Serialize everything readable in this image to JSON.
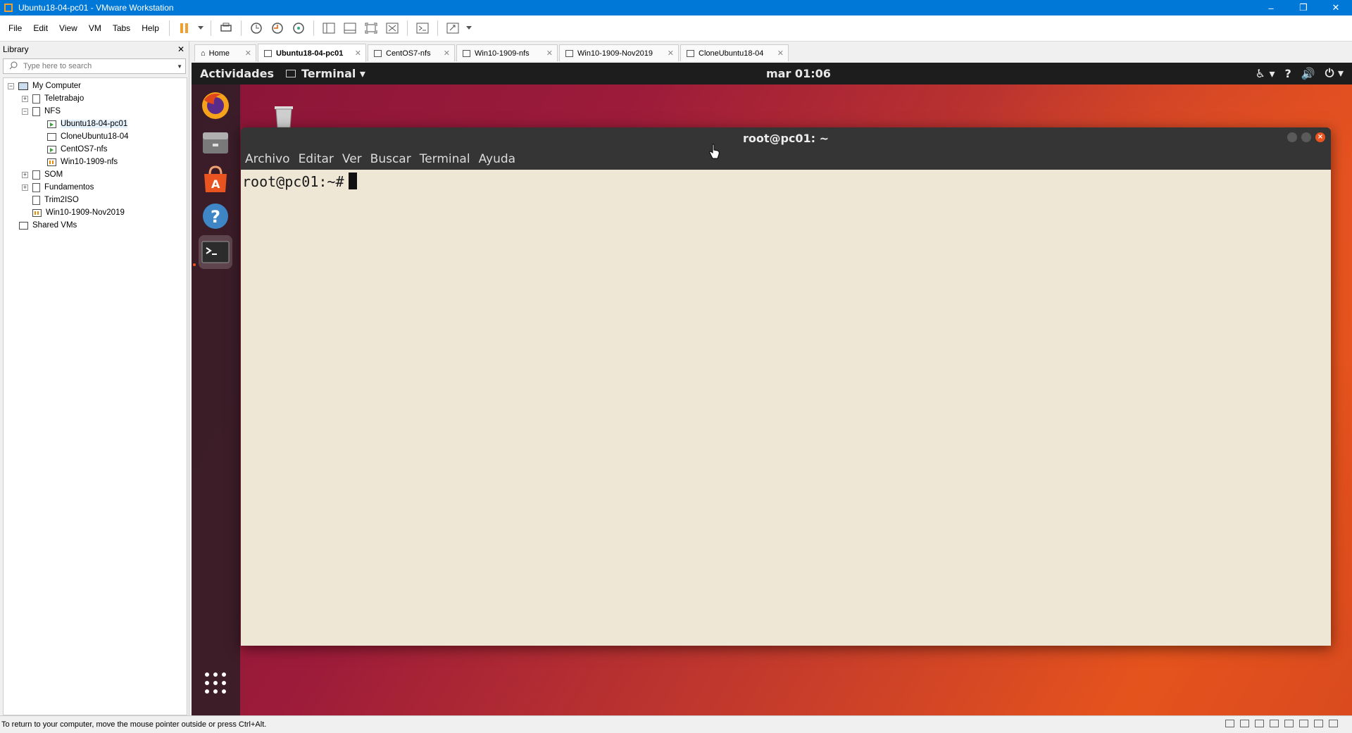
{
  "window": {
    "title": "Ubuntu18-04-pc01 - VMware Workstation",
    "controls": [
      "–",
      "❐",
      "✕"
    ]
  },
  "menubar": {
    "items": [
      "File",
      "Edit",
      "View",
      "VM",
      "Tabs",
      "Help"
    ]
  },
  "library": {
    "title": "Library",
    "close": "✕",
    "search_placeholder": "Type here to search",
    "tree": {
      "root": "My Computer",
      "teletrabajo": "Teletrabajo",
      "nfs": "NFS",
      "nfs_children": [
        "Ubuntu18-04-pc01",
        "CloneUbuntu18-04",
        "CentOS7-nfs",
        "Win10-1909-nfs"
      ],
      "som": "SOM",
      "fundamentos": "Fundamentos",
      "trim2iso": "Trim2ISO",
      "win10nov": "Win10-1909-Nov2019",
      "shared": "Shared VMs"
    }
  },
  "tabs": [
    "Home",
    "Ubuntu18-04-pc01",
    "CentOS7-nfs",
    "Win10-1909-nfs",
    "Win10-1909-Nov2019",
    "CloneUbuntu18-04"
  ],
  "tab_close": "✕",
  "ubuntu": {
    "activities": "Actividades",
    "app_menu": "Terminal ▾",
    "clock": "mar 01:06",
    "tray": [
      "♿ ▾",
      "?",
      "🔊",
      "⏻ ▾"
    ],
    "dock_apps": [
      "firefox",
      "files",
      "software",
      "help",
      "terminal"
    ],
    "show_apps": "⋮⋮⋮"
  },
  "terminal": {
    "title": "root@pc01: ~",
    "menu": [
      "Archivo",
      "Editar",
      "Ver",
      "Buscar",
      "Terminal",
      "Ayuda"
    ],
    "prompt": "root@pc01:~#"
  },
  "status": {
    "message": "To return to your computer, move the mouse pointer outside or press Ctrl+Alt."
  },
  "colors": {
    "titlebar": "#0078d7",
    "ubuntu_orange": "#e95420",
    "terminal_bg": "#efe7d6"
  }
}
